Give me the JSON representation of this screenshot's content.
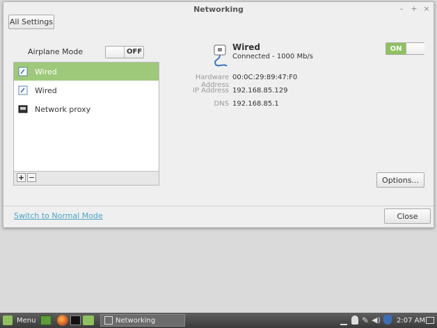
{
  "window": {
    "title": "Networking",
    "controls": {
      "minimize": "–",
      "maximize": "+",
      "close": "×"
    }
  },
  "toolbar": {
    "all_settings": "All Settings"
  },
  "airplane": {
    "label": "Airplane Mode",
    "state": "OFF"
  },
  "connections": [
    {
      "label": "Wired",
      "icon": "wired-icon",
      "selected": true
    },
    {
      "label": "Wired",
      "icon": "wired-icon",
      "selected": false
    },
    {
      "label": "Network proxy",
      "icon": "proxy-icon",
      "selected": false
    }
  ],
  "list_footer": {
    "add": "+",
    "remove": "−"
  },
  "detail": {
    "name": "Wired",
    "status": "Connected - 1000 Mb/s",
    "toggle": "ON",
    "hardware_label": "Hardware Address",
    "hardware_value": "00:0C:29:89:47:F0",
    "ip_label": "IP Address",
    "ip_value": "192.168.85.129",
    "dns_label": "DNS",
    "dns_value": "192.168.85.1",
    "options": "Options..."
  },
  "footer": {
    "switch_mode": "Switch to Normal Mode",
    "close": "Close"
  },
  "taskbar": {
    "menu": "Menu",
    "task": "Networking",
    "time": "2:07 AM"
  },
  "colors": {
    "accent": "#8fc15f",
    "selected_row": "#9fc97a",
    "link": "#4aa3c2"
  }
}
